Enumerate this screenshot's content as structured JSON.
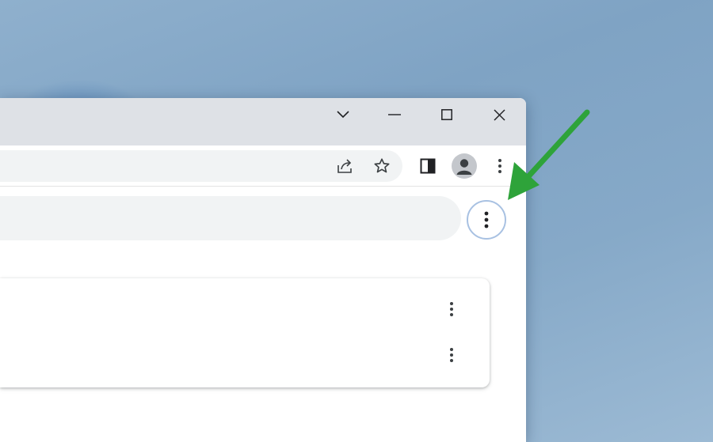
{
  "window_controls": {
    "tab_search": "chevron-down-icon",
    "minimize": "minimize-icon",
    "maximize": "maximize-icon",
    "close": "close-icon"
  },
  "toolbar": {
    "share": "share-icon",
    "bookmark": "star-icon",
    "side_panel": "side-panel-icon",
    "profile": "avatar-icon",
    "menu": "kebab-menu-icon"
  },
  "content": {
    "menu_button": "kebab-menu-icon",
    "list_rows": [
      {
        "menu": "kebab-menu-icon"
      },
      {
        "menu": "kebab-menu-icon"
      }
    ]
  },
  "colors": {
    "wallpaper": "#86a9c8",
    "titlebar": "#dee1e6",
    "omnibox": "#f1f3f4",
    "focus_ring": "#a8c1e2",
    "annotation_arrow": "#2ea33a",
    "icon": "#3c4043"
  }
}
